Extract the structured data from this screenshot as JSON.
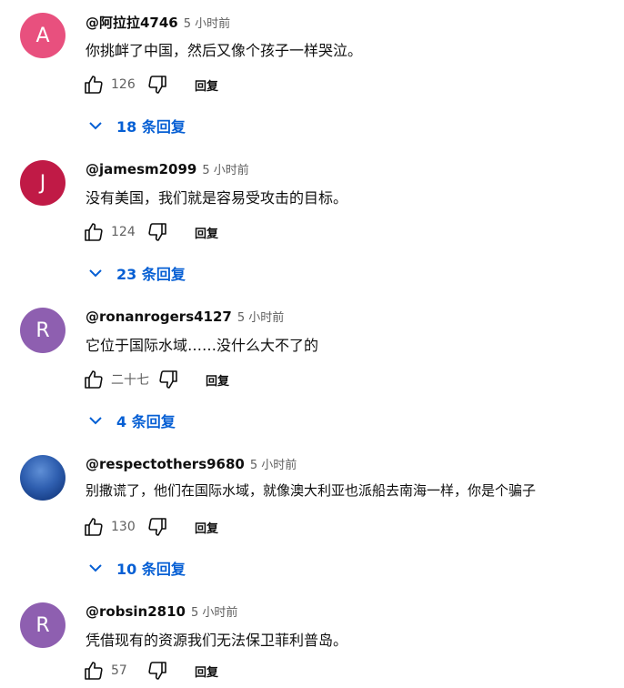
{
  "comments": [
    {
      "avatar_letter": "A",
      "avatar_color": "#e8507e",
      "handle": "@阿拉拉4746",
      "time": "5 小时前",
      "text": "你挑衅了中国，然后又像个孩子一样哭泣。",
      "likes": "126",
      "reply_label": "回复",
      "replies_label": "18 条回复"
    },
    {
      "avatar_letter": "J",
      "avatar_color": "#c01a46",
      "handle": "@jamesm2099",
      "time": "5 小时前",
      "text": "没有美国，我们就是容易受攻击的目标。",
      "likes": "124",
      "reply_label": "回复",
      "replies_label": "23 条回复"
    },
    {
      "avatar_letter": "R",
      "avatar_color": "#8e5fb0",
      "handle": "@ronanrogers4127",
      "time": "5 小时前",
      "text": "它位于国际水域……没什么大不了的",
      "likes": "二十七",
      "reply_label": "回复",
      "replies_label": "4 条回复"
    },
    {
      "avatar_letter": "",
      "avatar_color": "#2f5fb0",
      "handle": "@respectothers9680",
      "time": "5 小时前",
      "text": "别撒谎了，他们在国际水域，就像澳大利亚也派船去南海一样，你是个骗子",
      "likes": "130",
      "reply_label": "回复",
      "replies_label": "10 条回复"
    },
    {
      "avatar_letter": "R",
      "avatar_color": "#8e5fb0",
      "handle": "@robsin2810",
      "time": "5 小时前",
      "text": "凭借现有的资源我们无法保卫菲利普岛。",
      "likes": "57",
      "reply_label": "回复"
    }
  ]
}
